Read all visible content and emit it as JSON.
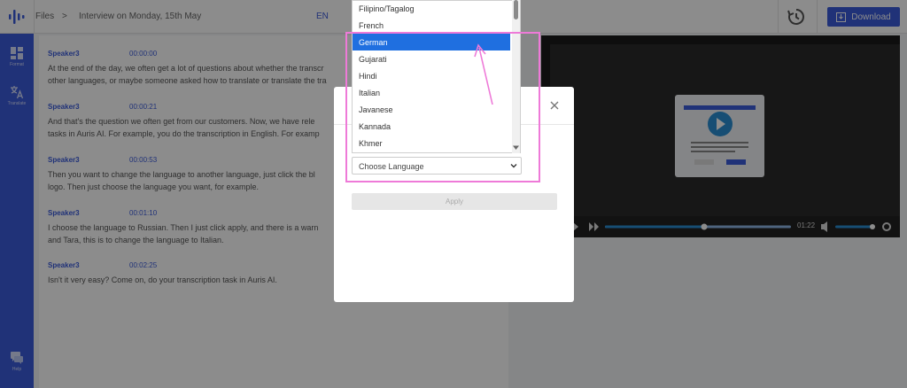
{
  "topbar": {
    "files_label": "Files",
    "separator": ">",
    "title": "Interview on Monday, 15th May",
    "language": "EN",
    "download_label": "Download"
  },
  "sidebar": {
    "items": [
      {
        "label": "Format",
        "icon": "format-icon"
      },
      {
        "label": "Translate",
        "icon": "translate-icon"
      },
      {
        "label": "Help",
        "icon": "help-icon"
      }
    ]
  },
  "transcript": {
    "segments": [
      {
        "speaker": "Speaker3",
        "time": "00:00:00",
        "text": "At the end of the day, we often get a lot of questions about whether the transcr\nother languages, or maybe someone asked how to translate or translate the tra"
      },
      {
        "speaker": "Speaker3",
        "time": "00:00:21",
        "text": "And that's the question we often get from our customers. Now, we have rele\ntasks in Auris AI. For example, you do the transcription in English. For examp"
      },
      {
        "speaker": "Speaker3",
        "time": "00:00:53",
        "text": "Then you want to change the language to another language, just click the bl\nlogo. Then just choose the language you want, for example."
      },
      {
        "speaker": "Speaker3",
        "time": "00:01:10",
        "text": "I choose the language to Russian. Then I just click apply, and there is a warn\nand Tara, this is to change the language to Italian."
      },
      {
        "speaker": "Speaker3",
        "time": "00:02:25",
        "text": "Isn't it very easy? Come on, do your transcription task in Auris AI."
      }
    ]
  },
  "video": {
    "time": "01:22"
  },
  "modal": {
    "select_value": "Choose Language",
    "apply_label": "Apply"
  },
  "dropdown": {
    "options": [
      "Filipino/Tagalog",
      "French",
      "German",
      "Gujarati",
      "Hindi",
      "Italian",
      "Javanese",
      "Kannada",
      "Khmer"
    ],
    "selected": "German"
  },
  "colors": {
    "accent": "#3b5bdb",
    "selected": "#1f6fe0",
    "highlight": "#ee7ad8"
  }
}
